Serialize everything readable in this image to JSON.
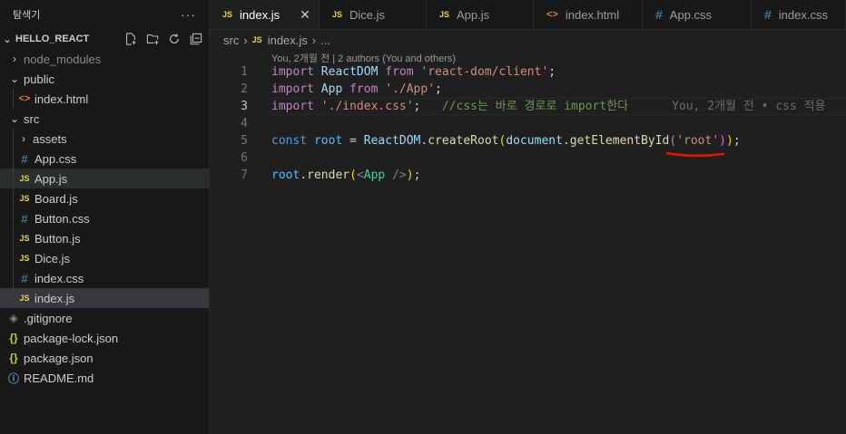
{
  "sidebar": {
    "header_title": "탐색기",
    "more_label": "···",
    "folder_name": "HELLO_REACT",
    "items": [
      {
        "label": "node_modules",
        "type": "folder",
        "expanded": false,
        "depth": 1
      },
      {
        "label": "public",
        "type": "folder",
        "expanded": true,
        "depth": 1
      },
      {
        "label": "index.html",
        "type": "html",
        "depth": 2
      },
      {
        "label": "src",
        "type": "folder",
        "expanded": true,
        "depth": 1
      },
      {
        "label": "assets",
        "type": "folder",
        "expanded": false,
        "depth": 2
      },
      {
        "label": "App.css",
        "type": "css",
        "depth": 2
      },
      {
        "label": "App.js",
        "type": "js",
        "depth": 2
      },
      {
        "label": "Board.js",
        "type": "js",
        "depth": 2
      },
      {
        "label": "Button.css",
        "type": "css",
        "depth": 2
      },
      {
        "label": "Button.js",
        "type": "js",
        "depth": 2
      },
      {
        "label": "Dice.js",
        "type": "js",
        "depth": 2
      },
      {
        "label": "index.css",
        "type": "css",
        "depth": 2
      },
      {
        "label": "index.js",
        "type": "js",
        "depth": 2
      },
      {
        "label": ".gitignore",
        "type": "git",
        "depth": 1
      },
      {
        "label": "package-lock.json",
        "type": "json",
        "depth": 1
      },
      {
        "label": "package.json",
        "type": "json",
        "depth": 1
      },
      {
        "label": "README.md",
        "type": "md",
        "depth": 1
      }
    ],
    "hovered_item": "App.js",
    "selected_item": "index.js"
  },
  "tabs": [
    {
      "label": "index.js",
      "type": "js",
      "active": true
    },
    {
      "label": "Dice.js",
      "type": "js",
      "active": false
    },
    {
      "label": "App.js",
      "type": "js",
      "active": false
    },
    {
      "label": "index.html",
      "type": "html",
      "active": false
    },
    {
      "label": "App.css",
      "type": "css",
      "active": false
    },
    {
      "label": "index.css",
      "type": "css",
      "active": false
    }
  ],
  "breadcrumb": {
    "folder": "src",
    "file": "index.js",
    "rest": "..."
  },
  "editor": {
    "blame_header": "You, 2개월 전 | 2 authors (You and others)",
    "current_line": 3,
    "inline_blame": "You, 2개월 전 • css 적용",
    "line_numbers": [
      "1",
      "2",
      "3",
      "4",
      "5",
      "6",
      "7"
    ],
    "lines": [
      [
        {
          "t": "import",
          "c": "kw"
        },
        {
          "t": " ",
          "c": "pun"
        },
        {
          "t": "ReactDOM",
          "c": "id"
        },
        {
          "t": " ",
          "c": "pun"
        },
        {
          "t": "from",
          "c": "kw"
        },
        {
          "t": " ",
          "c": "pun"
        },
        {
          "t": "'react-dom/client'",
          "c": "str"
        },
        {
          "t": ";",
          "c": "pun"
        }
      ],
      [
        {
          "t": "import",
          "c": "kw"
        },
        {
          "t": " ",
          "c": "pun"
        },
        {
          "t": "App",
          "c": "id"
        },
        {
          "t": " ",
          "c": "pun"
        },
        {
          "t": "from",
          "c": "kw"
        },
        {
          "t": " ",
          "c": "pun"
        },
        {
          "t": "'./App'",
          "c": "str"
        },
        {
          "t": ";",
          "c": "pun"
        }
      ],
      [
        {
          "t": "import",
          "c": "kw"
        },
        {
          "t": " ",
          "c": "pun"
        },
        {
          "t": "'./index.css'",
          "c": "str"
        },
        {
          "t": ";",
          "c": "pun"
        },
        {
          "t": "   ",
          "c": "pun"
        },
        {
          "t": "//css는 바로 경로로 import한다",
          "c": "cmt"
        }
      ],
      [],
      [
        {
          "t": "const",
          "c": "kw2"
        },
        {
          "t": " ",
          "c": "pun"
        },
        {
          "t": "root",
          "c": "id2"
        },
        {
          "t": " = ",
          "c": "pun"
        },
        {
          "t": "ReactDOM",
          "c": "id"
        },
        {
          "t": ".",
          "c": "pun"
        },
        {
          "t": "createRoot",
          "c": "fn"
        },
        {
          "t": "(",
          "c": "br1"
        },
        {
          "t": "document",
          "c": "id"
        },
        {
          "t": ".",
          "c": "pun"
        },
        {
          "t": "getElementById",
          "c": "fn"
        },
        {
          "t": "(",
          "c": "br2"
        },
        {
          "t": "'root'",
          "c": "str"
        },
        {
          "t": ")",
          "c": "br2"
        },
        {
          "t": ")",
          "c": "br1"
        },
        {
          "t": ";",
          "c": "pun"
        }
      ],
      [],
      [
        {
          "t": "root",
          "c": "id2"
        },
        {
          "t": ".",
          "c": "pun"
        },
        {
          "t": "render",
          "c": "fn"
        },
        {
          "t": "(",
          "c": "br1"
        },
        {
          "t": "<",
          "c": "tagp"
        },
        {
          "t": "App",
          "c": "tag"
        },
        {
          "t": " ",
          "c": "pun"
        },
        {
          "t": "/>",
          "c": "tagp"
        },
        {
          "t": ")",
          "c": "br1"
        },
        {
          "t": ";",
          "c": "pun"
        }
      ]
    ],
    "annotation_color": "#e51400"
  }
}
